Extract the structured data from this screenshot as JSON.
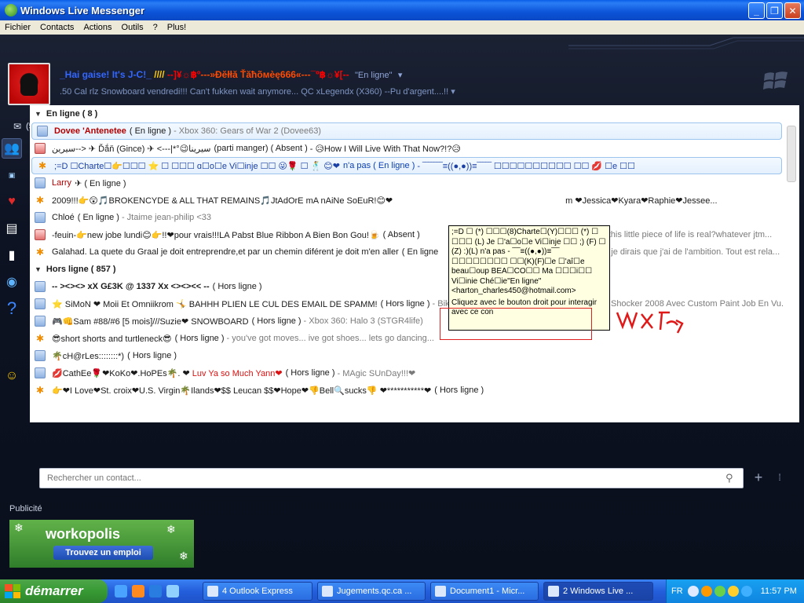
{
  "window": {
    "title": "Windows Live Messenger"
  },
  "menu": [
    "Fichier",
    "Contacts",
    "Actions",
    "Outils",
    "?",
    "Plus!"
  ],
  "profile": {
    "name_part1": "_Hai gaise! It's J-C!_",
    "name_part2": " //// ",
    "name_part3": "--]¥☼฿º",
    "name_part4": "---»Ðĕłłă Ťăħõмèę666«---",
    "name_part5": "¯º฿☼¥[--",
    "status": "\"En ligne\"",
    "personal_message": ".50 Cal rlz    Snowboard vendredi!!! Can't fukken wait anymore...   QC xLegendx (X360)   --Pu d'argent....!!"
  },
  "toolbar": {
    "mail_count": "(5)"
  },
  "groups": {
    "online_label": "En ligne ( 8 )",
    "offline_label": "Hors ligne ( 857 )"
  },
  "online_contacts": [
    {
      "name": "Dovee 'Antenetee",
      "state": "( En ligne )",
      "psm": "- Xbox 360: Gears of War 2 (Dovee63)"
    },
    {
      "name": "سيرين--> ✈ Ďắň (Gince) ✈ <---|*°😉سيرينا",
      "state": "(parti manger)  ( Absent )",
      "psm": "- 😥How I Will Live With That Now?!?😥"
    },
    {
      "name": ";=D  ☐Charte☐👉☐☐☐ ⭐ ☐       ☐☐☐ ɑ☐o☐e Vi☐inje ☐☐ 😜🌹 ☐ 🕺           😊❤",
      "state": "n'a pas ( En ligne )",
      "psm": "- ‾‾‾‾‾‾‾≡((●,●))≡‾‾‾‾‾  ☐☐☐☐☐☐☐☐☐☐  ☐☐ 💋 ☐e ☐☐"
    },
    {
      "name": "Larry",
      "state": "✈   ( En ligne )",
      "psm": ""
    },
    {
      "name": "2009!!!👉😲🎵BROKENCYDE & ALL THAT REMAINS🎵JtAdOrE mA nAiNe SoEuR!😊❤",
      "state": "",
      "psm": "m ❤Jessica❤Kyara❤Raphie❤Jessee..."
    },
    {
      "name": "Chloé",
      "state": "( En ligne )",
      "psm": "- Jtaime jean-philip <33"
    },
    {
      "name": "-feuin-👉new jobe lundi😊👉!!❤pour vrais!!!LA Pabst Blue Ribbon A Bien Bon Gou!🍺",
      "state": "( Absent )",
      "psm": "this little piece of life is real?whatever jtm..."
    },
    {
      "name": "Galahad. La quete du Graal je doit entreprendre,et par un chemin diférent je doit m'en aller",
      "state": "( En ligne",
      "psm": "je dirais que j'ai de l'ambition. Tout est rela..."
    }
  ],
  "offline_contacts": [
    {
      "name": "-- ><><> xX G£3K @ 1337 Xx <><><< --",
      "state": "( Hors ligne )",
      "psm": ""
    },
    {
      "name": "⭐ SiMoN ❤  Moii Et Omniikrom 🤸 BAHHH PLIEN LE CUL DES EMAIL DE SPAMM!",
      "state": "( Hors ligne )",
      "psm": "- Bike De DH à Vendre , 1700  $  Neg // // Cove Shocker 2008 Avec Custom Paint Job En Vu..."
    },
    {
      "name": "🎮👊Sam #88/#6           [5 mois]///Suzie❤ SNOWBOARD",
      "state": "( Hors ligne )",
      "psm": "- Xbox 360: Halo 3 (STGR4life)"
    },
    {
      "name": "😎short shorts and turtleneck😎",
      "state": "( Hors ligne )",
      "psm": "- you've got moves... ive got shoes... lets go dancing..."
    },
    {
      "name": "🌴cH@rLes::::::::*)",
      "state": "( Hors ligne )",
      "psm": ""
    },
    {
      "name": "💋CathEe🌹❤KoKo❤.HoPEs🌴.           ❤",
      "state": "( Hors ligne )",
      "psm": "Luv Ya so Much Yann❤"
    },
    {
      "name": "👉❤I Love❤St. croix❤U.S. Virgin🌴Ilands❤$$ Leucan $$❤Hope❤👎Bell🔍sucks👎 ❤***********❤",
      "state": "( Hors ligne )",
      "psm": ""
    }
  ],
  "offline_contacts_extra_psm": "- MAgic SUnDay!!!❤",
  "tooltip": {
    "text": ";=D   ☐ (*) ☐☐☐(8)Charte☐(Y)☐☐☐ (*) ☐    ☐☐☐ (L) Je ☐'a☐o☐e Vi☐inje ☐☐ ;) (F)  ☐ (Z)    :)(L)    n'a pas - ‾‾‾≡((●,●))≡‾‾‾ ☐☐☐☐☐☐☐☐   ☐☐(K)(F)☐e ☐'aî☐e beau☐oup BEA☐CO☐☐ Ma ☐☐☐i☐☐ Vi☐inie Ché☐ie\"En ligne\" <harton_charles450@hotmail.com>",
    "hint": "Cliquez avec le bouton droit pour interagir avec ce con"
  },
  "search": {
    "placeholder": "Rechercher un contact..."
  },
  "ad": {
    "label": "Publicité",
    "brand": "workopolis",
    "cta": "Trouvez un emploi"
  },
  "taskbar": {
    "start": "démarrer",
    "tasks": [
      "4 Outlook Express",
      "Jugements.qc.ca ...",
      "Document1 - Micr...",
      "2 Windows Live ..."
    ],
    "lang": "FR",
    "clock": "11:57 PM"
  },
  "colors": {
    "titlebar": "#0b53d8",
    "messenger_bg": "#0d1322",
    "start": "#379a34",
    "tooltip_bg": "#ffffe1"
  }
}
